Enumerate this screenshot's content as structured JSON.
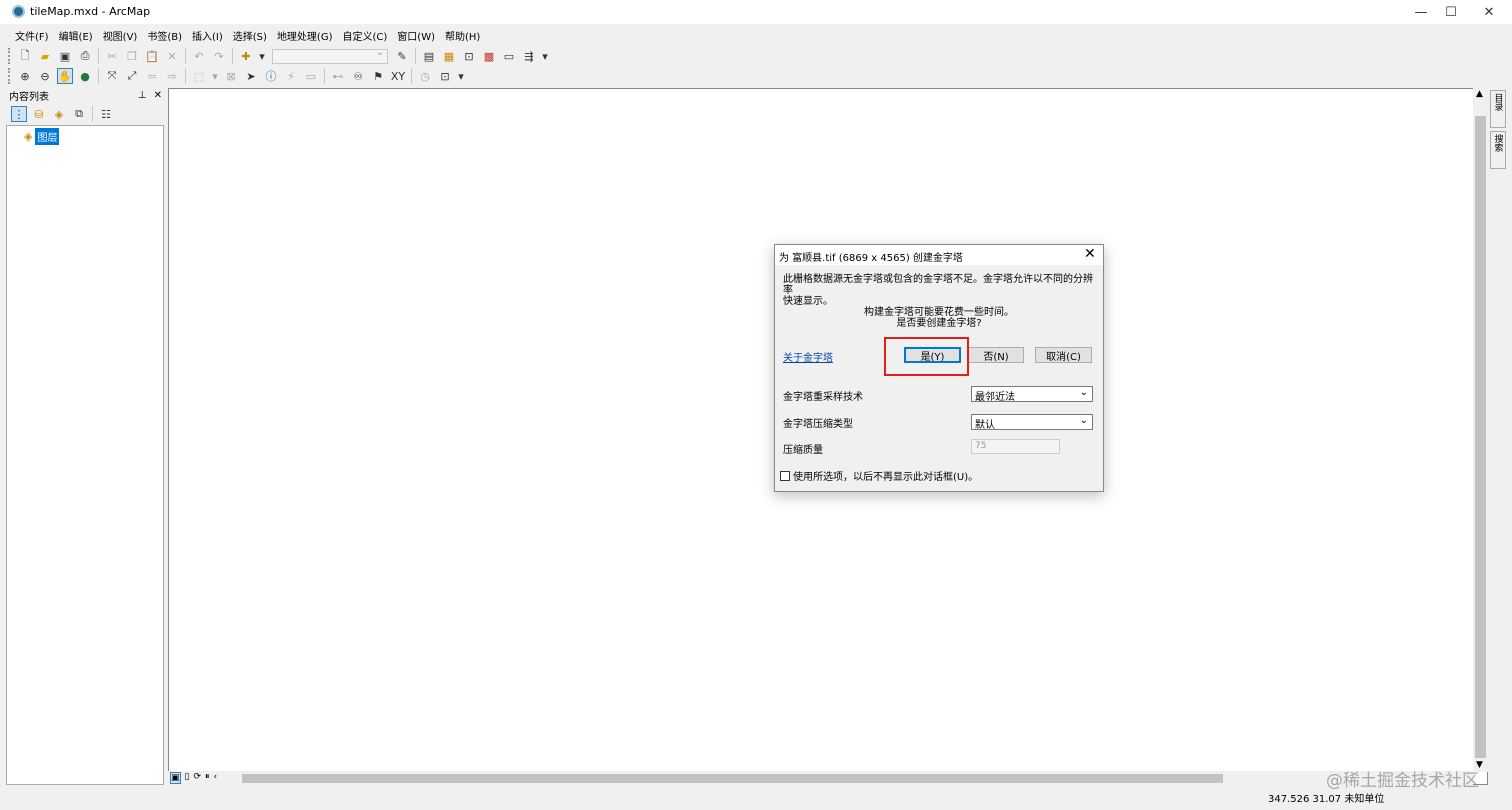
{
  "window": {
    "title": "tileMap.mxd - ArcMap",
    "minimize_glyph": "—",
    "maximize_glyph": "☐",
    "close_glyph": "✕"
  },
  "menu": [
    "文件(F)",
    "编辑(E)",
    "视图(V)",
    "书签(B)",
    "插入(I)",
    "选择(S)",
    "地理处理(G)",
    "自定义(C)",
    "窗口(W)",
    "帮助(H)"
  ],
  "toc": {
    "title": "内容列表",
    "pin_glyph": "𝟦",
    "close_glyph": "✕",
    "root_layer": "图层"
  },
  "dock_tabs": [
    "目录",
    "搜索"
  ],
  "status": {
    "coords": "347.526  31.07 未知单位"
  },
  "watermark": "@稀土掘金技术社区",
  "dialog": {
    "title": "为 富顺县.tif (6869 x 4565) 创建金字塔",
    "message_line1": "此栅格数据源无金字塔或包含的金字塔不足。金字塔允许以不同的分辨率",
    "message_line2": "快速显示。",
    "question_line1": "构建金字塔可能要花费一些时间。",
    "question_line2": "是否要创建金字塔?",
    "about_link": "关于金字塔",
    "yes_button": "是(Y)",
    "no_button": "否(N)",
    "cancel_button": "取消(C)",
    "resample_label": "金字塔重采样技术",
    "resample_value": "最邻近法",
    "compression_label": "金字塔压缩类型",
    "compression_value": "默认",
    "quality_label": "压缩质量",
    "quality_value": "75",
    "remember_label": "使用所选项，以后不再显示此对话框(U)。"
  }
}
